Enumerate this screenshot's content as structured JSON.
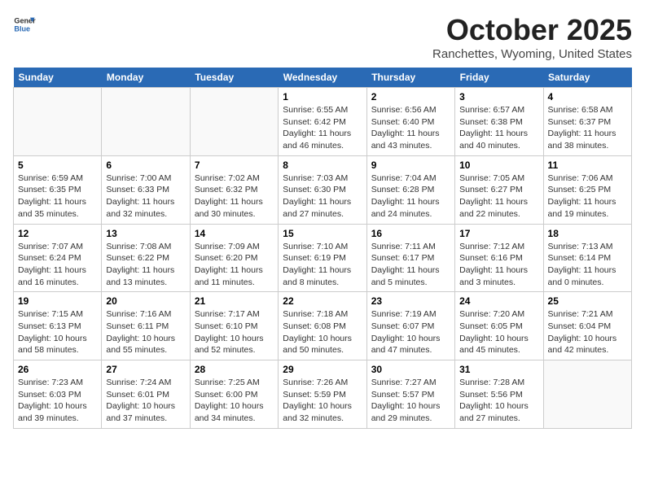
{
  "header": {
    "logo_general": "General",
    "logo_blue": "Blue",
    "month": "October 2025",
    "location": "Ranchettes, Wyoming, United States"
  },
  "days_of_week": [
    "Sunday",
    "Monday",
    "Tuesday",
    "Wednesday",
    "Thursday",
    "Friday",
    "Saturday"
  ],
  "weeks": [
    [
      {
        "day": "",
        "content": ""
      },
      {
        "day": "",
        "content": ""
      },
      {
        "day": "",
        "content": ""
      },
      {
        "day": "1",
        "content": "Sunrise: 6:55 AM\nSunset: 6:42 PM\nDaylight: 11 hours\nand 46 minutes."
      },
      {
        "day": "2",
        "content": "Sunrise: 6:56 AM\nSunset: 6:40 PM\nDaylight: 11 hours\nand 43 minutes."
      },
      {
        "day": "3",
        "content": "Sunrise: 6:57 AM\nSunset: 6:38 PM\nDaylight: 11 hours\nand 40 minutes."
      },
      {
        "day": "4",
        "content": "Sunrise: 6:58 AM\nSunset: 6:37 PM\nDaylight: 11 hours\nand 38 minutes."
      }
    ],
    [
      {
        "day": "5",
        "content": "Sunrise: 6:59 AM\nSunset: 6:35 PM\nDaylight: 11 hours\nand 35 minutes."
      },
      {
        "day": "6",
        "content": "Sunrise: 7:00 AM\nSunset: 6:33 PM\nDaylight: 11 hours\nand 32 minutes."
      },
      {
        "day": "7",
        "content": "Sunrise: 7:02 AM\nSunset: 6:32 PM\nDaylight: 11 hours\nand 30 minutes."
      },
      {
        "day": "8",
        "content": "Sunrise: 7:03 AM\nSunset: 6:30 PM\nDaylight: 11 hours\nand 27 minutes."
      },
      {
        "day": "9",
        "content": "Sunrise: 7:04 AM\nSunset: 6:28 PM\nDaylight: 11 hours\nand 24 minutes."
      },
      {
        "day": "10",
        "content": "Sunrise: 7:05 AM\nSunset: 6:27 PM\nDaylight: 11 hours\nand 22 minutes."
      },
      {
        "day": "11",
        "content": "Sunrise: 7:06 AM\nSunset: 6:25 PM\nDaylight: 11 hours\nand 19 minutes."
      }
    ],
    [
      {
        "day": "12",
        "content": "Sunrise: 7:07 AM\nSunset: 6:24 PM\nDaylight: 11 hours\nand 16 minutes."
      },
      {
        "day": "13",
        "content": "Sunrise: 7:08 AM\nSunset: 6:22 PM\nDaylight: 11 hours\nand 13 minutes."
      },
      {
        "day": "14",
        "content": "Sunrise: 7:09 AM\nSunset: 6:20 PM\nDaylight: 11 hours\nand 11 minutes."
      },
      {
        "day": "15",
        "content": "Sunrise: 7:10 AM\nSunset: 6:19 PM\nDaylight: 11 hours\nand 8 minutes."
      },
      {
        "day": "16",
        "content": "Sunrise: 7:11 AM\nSunset: 6:17 PM\nDaylight: 11 hours\nand 5 minutes."
      },
      {
        "day": "17",
        "content": "Sunrise: 7:12 AM\nSunset: 6:16 PM\nDaylight: 11 hours\nand 3 minutes."
      },
      {
        "day": "18",
        "content": "Sunrise: 7:13 AM\nSunset: 6:14 PM\nDaylight: 11 hours\nand 0 minutes."
      }
    ],
    [
      {
        "day": "19",
        "content": "Sunrise: 7:15 AM\nSunset: 6:13 PM\nDaylight: 10 hours\nand 58 minutes."
      },
      {
        "day": "20",
        "content": "Sunrise: 7:16 AM\nSunset: 6:11 PM\nDaylight: 10 hours\nand 55 minutes."
      },
      {
        "day": "21",
        "content": "Sunrise: 7:17 AM\nSunset: 6:10 PM\nDaylight: 10 hours\nand 52 minutes."
      },
      {
        "day": "22",
        "content": "Sunrise: 7:18 AM\nSunset: 6:08 PM\nDaylight: 10 hours\nand 50 minutes."
      },
      {
        "day": "23",
        "content": "Sunrise: 7:19 AM\nSunset: 6:07 PM\nDaylight: 10 hours\nand 47 minutes."
      },
      {
        "day": "24",
        "content": "Sunrise: 7:20 AM\nSunset: 6:05 PM\nDaylight: 10 hours\nand 45 minutes."
      },
      {
        "day": "25",
        "content": "Sunrise: 7:21 AM\nSunset: 6:04 PM\nDaylight: 10 hours\nand 42 minutes."
      }
    ],
    [
      {
        "day": "26",
        "content": "Sunrise: 7:23 AM\nSunset: 6:03 PM\nDaylight: 10 hours\nand 39 minutes."
      },
      {
        "day": "27",
        "content": "Sunrise: 7:24 AM\nSunset: 6:01 PM\nDaylight: 10 hours\nand 37 minutes."
      },
      {
        "day": "28",
        "content": "Sunrise: 7:25 AM\nSunset: 6:00 PM\nDaylight: 10 hours\nand 34 minutes."
      },
      {
        "day": "29",
        "content": "Sunrise: 7:26 AM\nSunset: 5:59 PM\nDaylight: 10 hours\nand 32 minutes."
      },
      {
        "day": "30",
        "content": "Sunrise: 7:27 AM\nSunset: 5:57 PM\nDaylight: 10 hours\nand 29 minutes."
      },
      {
        "day": "31",
        "content": "Sunrise: 7:28 AM\nSunset: 5:56 PM\nDaylight: 10 hours\nand 27 minutes."
      },
      {
        "day": "",
        "content": ""
      }
    ]
  ]
}
